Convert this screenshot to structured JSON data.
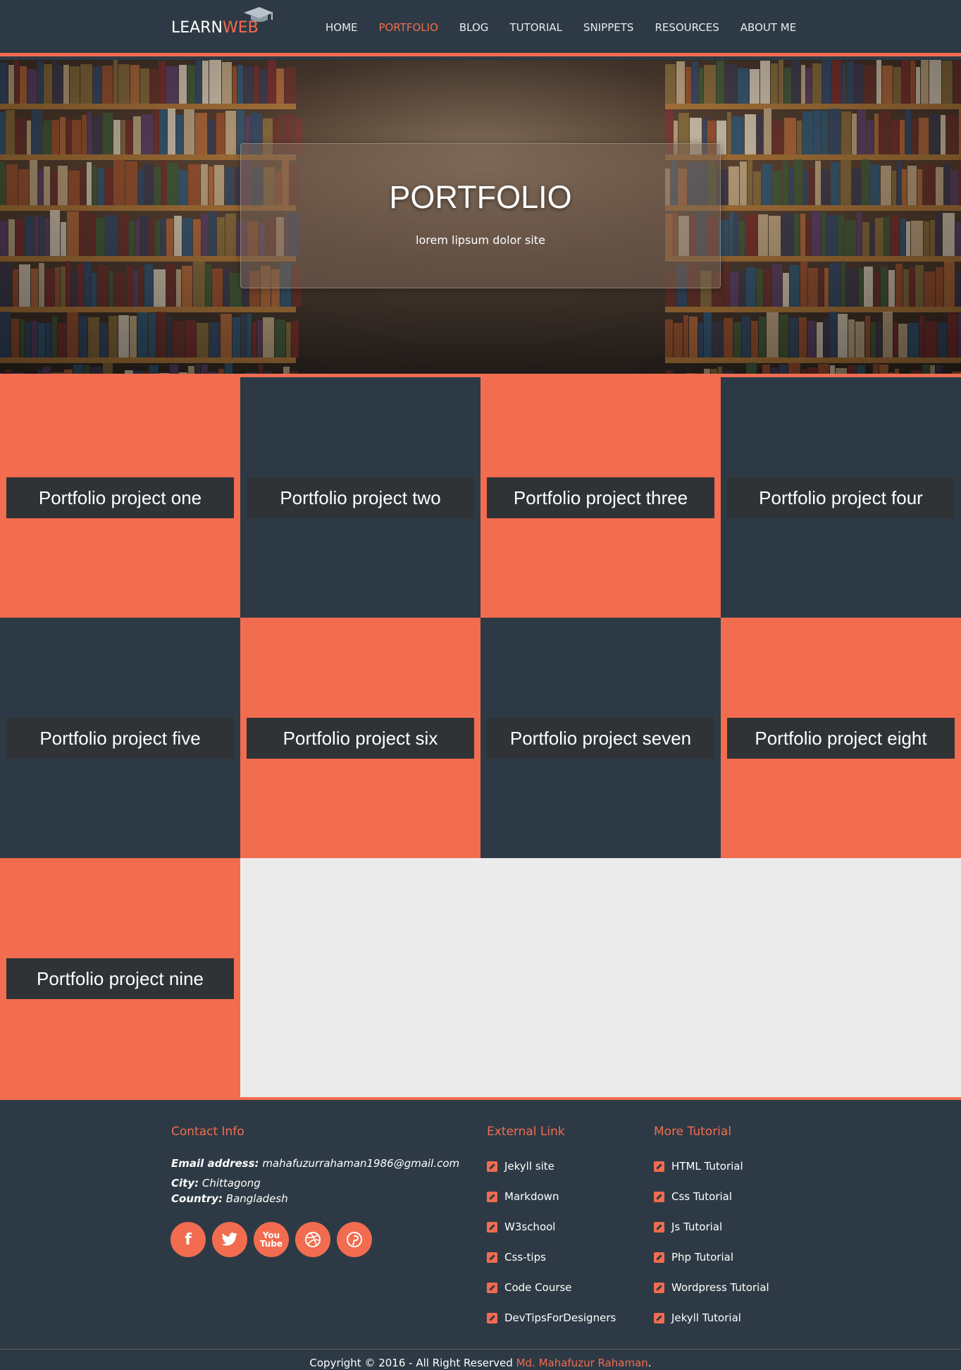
{
  "nav": {
    "logo_part1": "LEARN",
    "logo_part2": "WEB",
    "items": [
      "HOME",
      "PORTFOLIO",
      "BLOG",
      "TUTORIAL",
      "SNIPPETS",
      "RESOURCES",
      "ABOUT ME"
    ],
    "active_index": 1
  },
  "hero": {
    "title": "PORTFOLIO",
    "subtitle": "lorem lipsum dolor site"
  },
  "portfolio": {
    "projects": [
      {
        "label": "Portfolio project one",
        "color": "orange"
      },
      {
        "label": "Portfolio project two",
        "color": "dark"
      },
      {
        "label": "Portfolio project three",
        "color": "orange"
      },
      {
        "label": "Portfolio project four",
        "color": "dark"
      },
      {
        "label": "Portfolio project five",
        "color": "dark"
      },
      {
        "label": "Portfolio project six",
        "color": "orange"
      },
      {
        "label": "Portfolio project seven",
        "color": "dark"
      },
      {
        "label": "Portfolio project eight",
        "color": "orange"
      },
      {
        "label": "Portfolio project nine",
        "color": "orange"
      }
    ]
  },
  "footer": {
    "contact": {
      "title": "Contact Info",
      "email_label": "Email address:",
      "email": "mahafuzurrahaman1986@gmail.com",
      "city_label": "City:",
      "city": "Chittagong",
      "country_label": "Country:",
      "country": "Bangladesh"
    },
    "social": [
      "facebook-icon",
      "twitter-icon",
      "youtube-icon",
      "dribbble-icon",
      "pinterest-icon"
    ],
    "external": {
      "title": "External Link",
      "links": [
        "Jekyll site",
        "Markdown",
        "W3school",
        "Css-tips",
        "Code Course",
        "DevTipsForDesigners"
      ]
    },
    "tutorial": {
      "title": "More Tutorial",
      "links": [
        "HTML Tutorial",
        "Css Tutorial",
        "Js Tutorial",
        "Php Tutorial",
        "Wordpress Tutorial",
        "Jekyll Tutorial"
      ]
    },
    "copyright_prefix": "Copyright © 2016 - All Right Reserved",
    "author": "Md. Mahafuzur Rahaman",
    "copyright_suffix": "."
  },
  "colors": {
    "accent": "#f26c4f",
    "dark": "#2d3a45",
    "label_bg": "#2f3336",
    "empty_bg": "#ebebeb"
  }
}
